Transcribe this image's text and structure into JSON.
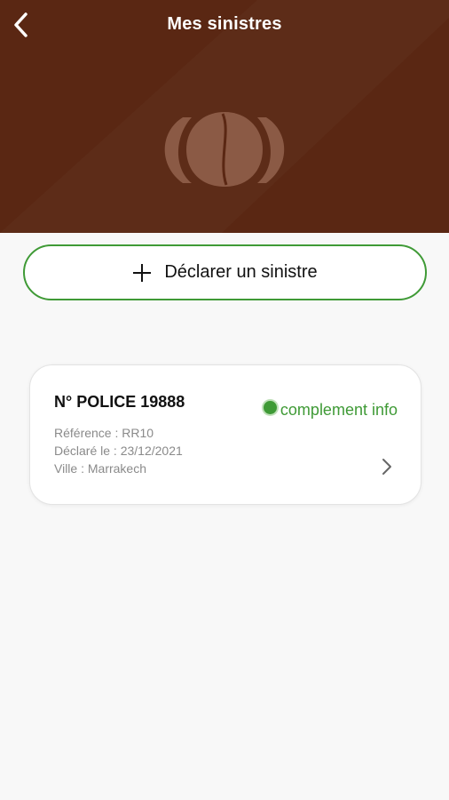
{
  "header": {
    "title": "Mes sinistres",
    "back_icon": "chevron-left-icon",
    "logo_icon": "insurer-logo",
    "background_color": "#5a2713"
  },
  "actions": {
    "declare_label": "Déclarer un sinistre",
    "declare_icon": "plus-icon",
    "accent_color": "#3f9a36"
  },
  "claims": [
    {
      "police_number": "N° POLICE 19888",
      "status": "complement info",
      "status_color": "#3f9a36",
      "reference": "Référence : RR10",
      "declared": "Déclaré le : 23/12/2021",
      "city": "Ville : Marrakech"
    }
  ]
}
